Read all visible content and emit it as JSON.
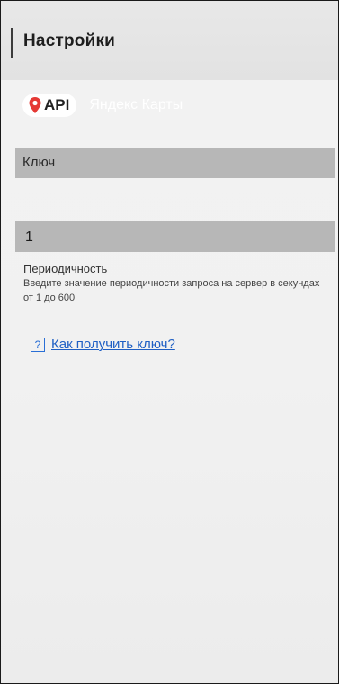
{
  "header": {
    "title": "Настройки"
  },
  "provider": {
    "api_label": "API",
    "service_label": "Яндекс Карты",
    "pin_color": "#e53935"
  },
  "fields": {
    "key": {
      "placeholder": "Ключ",
      "value": ""
    },
    "period": {
      "value": "1",
      "label": "Периодичность",
      "hint": "Введите значение периодичности запроса на сервер в секундах от 1 до 600"
    }
  },
  "help": {
    "icon": "question-icon",
    "icon_glyph": "?",
    "link_text": "Как получить ключ?"
  },
  "colors": {
    "header_bg": "#e4e4e4",
    "field_bg": "#b7b7b7",
    "link": "#1f5fc4"
  }
}
